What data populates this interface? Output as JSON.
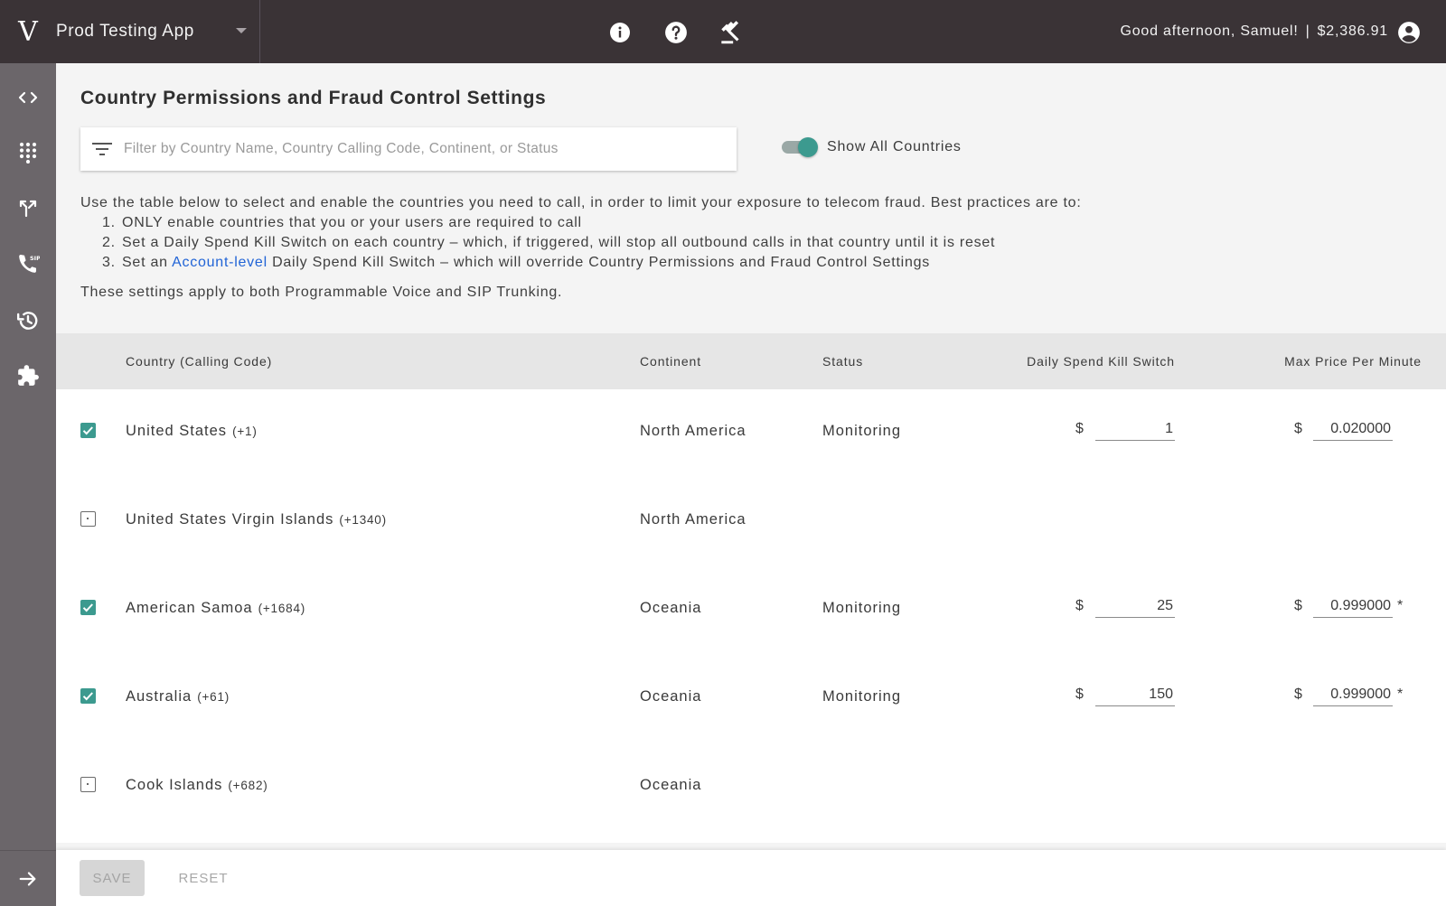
{
  "topbar": {
    "logo": "V",
    "app_name": "Prod Testing App",
    "greeting": "Good afternoon, Samuel!",
    "separator": "|",
    "balance": "$2,386.91",
    "icons": [
      "info-icon",
      "help-icon",
      "gavel-icon",
      "account-circle-icon"
    ]
  },
  "sidebar": {
    "items": [
      "code-icon",
      "dialpad-icon",
      "call-split-icon",
      "sip-phone-icon",
      "history-icon",
      "extension-icon"
    ],
    "expand": "arrow-right-icon"
  },
  "page": {
    "title": "Country Permissions and Fraud Control Settings",
    "filter_placeholder": "Filter by Country Name, Country Calling Code, Continent, or Status",
    "toggle_label": "Show All Countries",
    "intro": "Use the table below to select and enable the countries you need to call, in order to limit your exposure to telecom fraud. Best practices are to:",
    "practice_1": "ONLY enable countries that you or your users are required to call",
    "practice_2": "Set a Daily Spend Kill Switch on each country – which, if triggered, will stop all outbound calls in that country until it is reset",
    "practice_3_pre": "Set an",
    "practice_3_link": "Account-level",
    "practice_3_post": "Daily Spend Kill Switch – which will override Country Permissions and Fraud Control Settings",
    "applies": "These settings apply to both Programmable Voice and SIP Trunking."
  },
  "table": {
    "headers": {
      "country": "Country (Calling Code)",
      "continent": "Continent",
      "status": "Status",
      "kill_switch": "Daily Spend Kill Switch",
      "max_price": "Max Price Per Minute"
    },
    "currency": "$",
    "rows": [
      {
        "checked": true,
        "country": "United States",
        "code": "(+1)",
        "continent": "North America",
        "status": "Monitoring",
        "kill_switch": "1",
        "max_price": "0.020000",
        "star": ""
      },
      {
        "checked": false,
        "country": "United States Virgin Islands",
        "code": "(+1340)",
        "continent": "North America",
        "status": "",
        "kill_switch": "",
        "max_price": "",
        "star": ""
      },
      {
        "checked": true,
        "country": "American Samoa",
        "code": "(+1684)",
        "continent": "Oceania",
        "status": "Monitoring",
        "kill_switch": "25",
        "max_price": "0.999000",
        "star": "*"
      },
      {
        "checked": true,
        "country": "Australia",
        "code": "(+61)",
        "continent": "Oceania",
        "status": "Monitoring",
        "kill_switch": "150",
        "max_price": "0.999000",
        "star": "*"
      },
      {
        "checked": false,
        "country": "Cook Islands",
        "code": "(+682)",
        "continent": "Oceania",
        "status": "",
        "kill_switch": "",
        "max_price": "",
        "star": ""
      }
    ]
  },
  "footer": {
    "save": "SAVE",
    "reset": "RESET"
  },
  "colors": {
    "topbar": "#3a3336",
    "sidebar": "#6b666a",
    "accent": "#3c9a8f",
    "link": "#2164d6"
  }
}
